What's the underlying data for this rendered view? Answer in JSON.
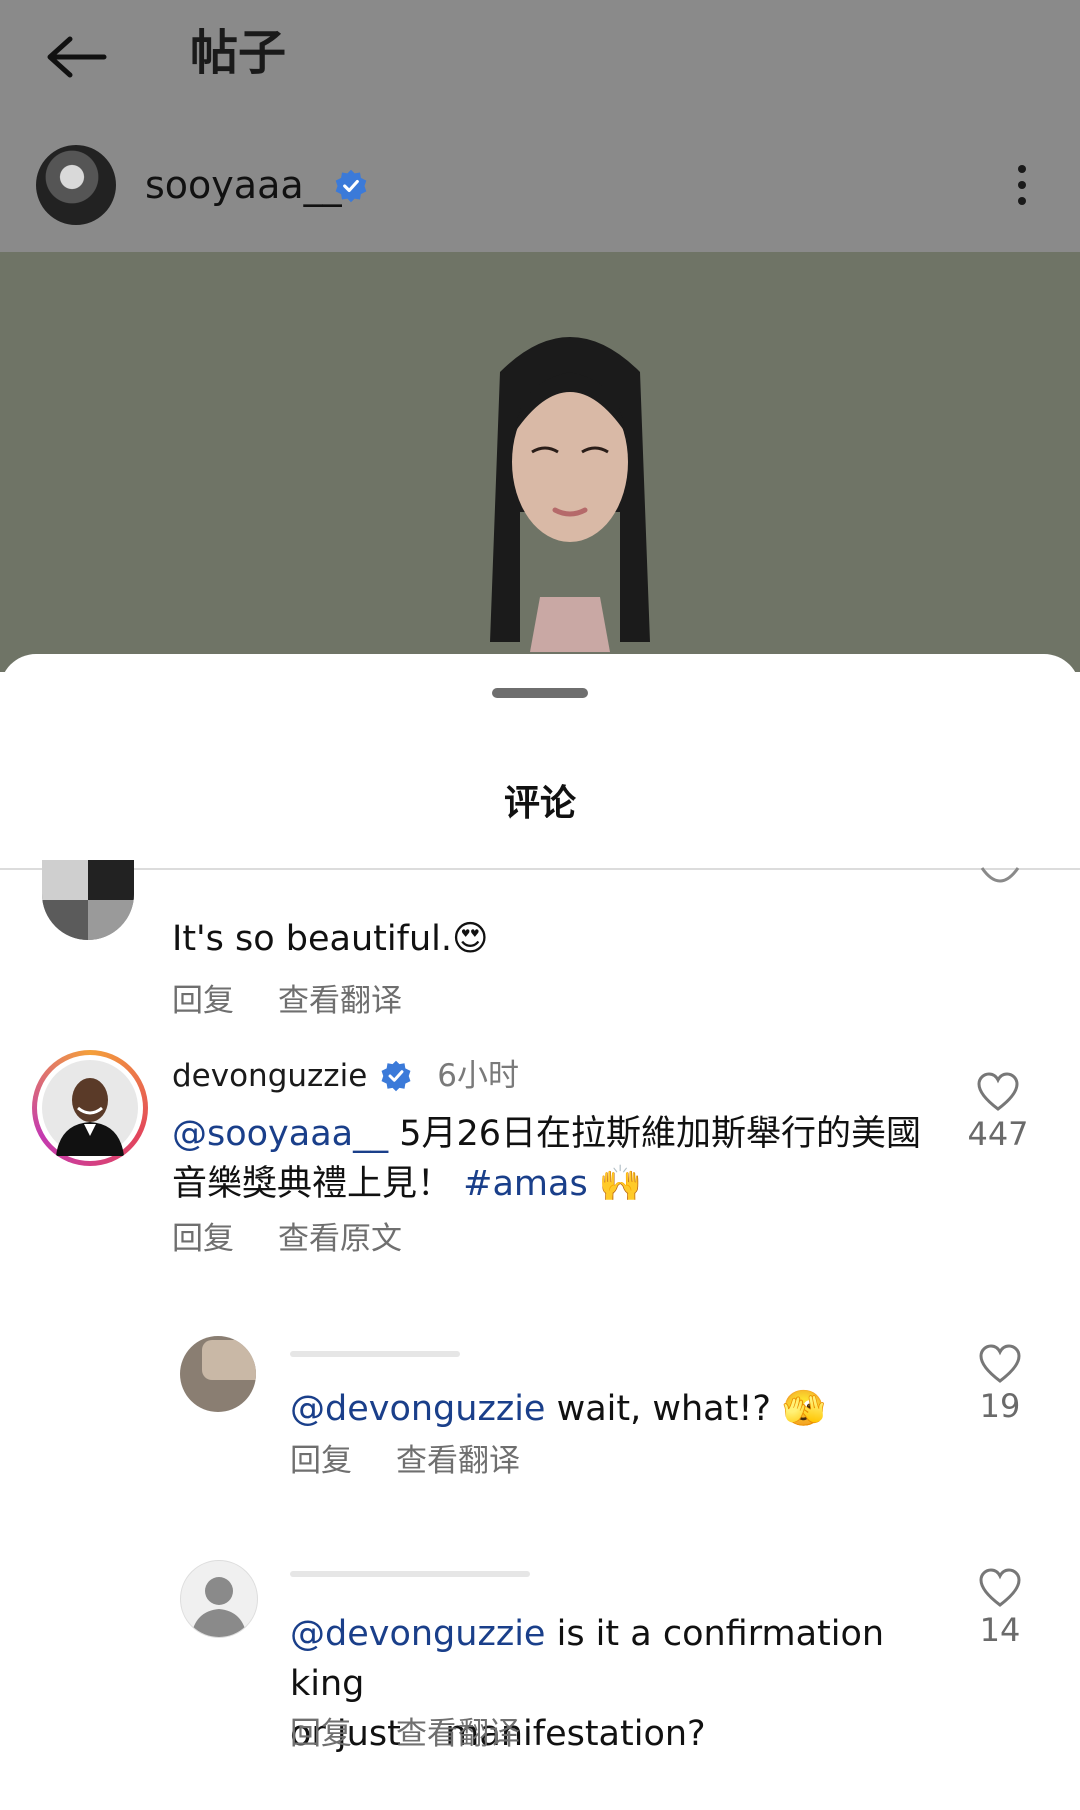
{
  "header": {
    "title": "帖子"
  },
  "post": {
    "username": "sooyaaa__"
  },
  "sheet": {
    "title": "评论"
  },
  "comments": [
    {
      "text": "It's so beautiful.",
      "emoji": "😍",
      "actions": [
        "回复",
        "查看翻译"
      ]
    },
    {
      "username": "devonguzzie",
      "time": "6小时",
      "mention": "@sooyaaa__",
      "text_line1": " 5月26日在拉斯維加斯舉行的美國",
      "text_line2": "音樂獎典禮上見！",
      "hashtag": "#amas",
      "emoji": "🙌",
      "likes": "447",
      "actions": [
        "回复",
        "查看原文"
      ]
    },
    {
      "mention": "@devonguzzie",
      "text": " wait, what!?",
      "emoji": "🫣",
      "likes": "19",
      "actions": [
        "回复",
        "查看翻译"
      ]
    },
    {
      "mention": "@devonguzzie",
      "text_line1": " is it a confirmation king",
      "text_line2": "or just    manifestation?",
      "likes": "14",
      "actions": [
        "回复",
        "查看翻译"
      ]
    }
  ],
  "icons": {
    "back": "arrow-left-icon",
    "verified": "verified-badge-icon",
    "more": "more-vertical-icon",
    "like": "heart-outline-icon"
  },
  "colors": {
    "verified": "#3b7ad9",
    "mention": "#1a3f8a",
    "story_ring_start": "#f4a03a",
    "story_ring_end": "#c43ab0"
  }
}
